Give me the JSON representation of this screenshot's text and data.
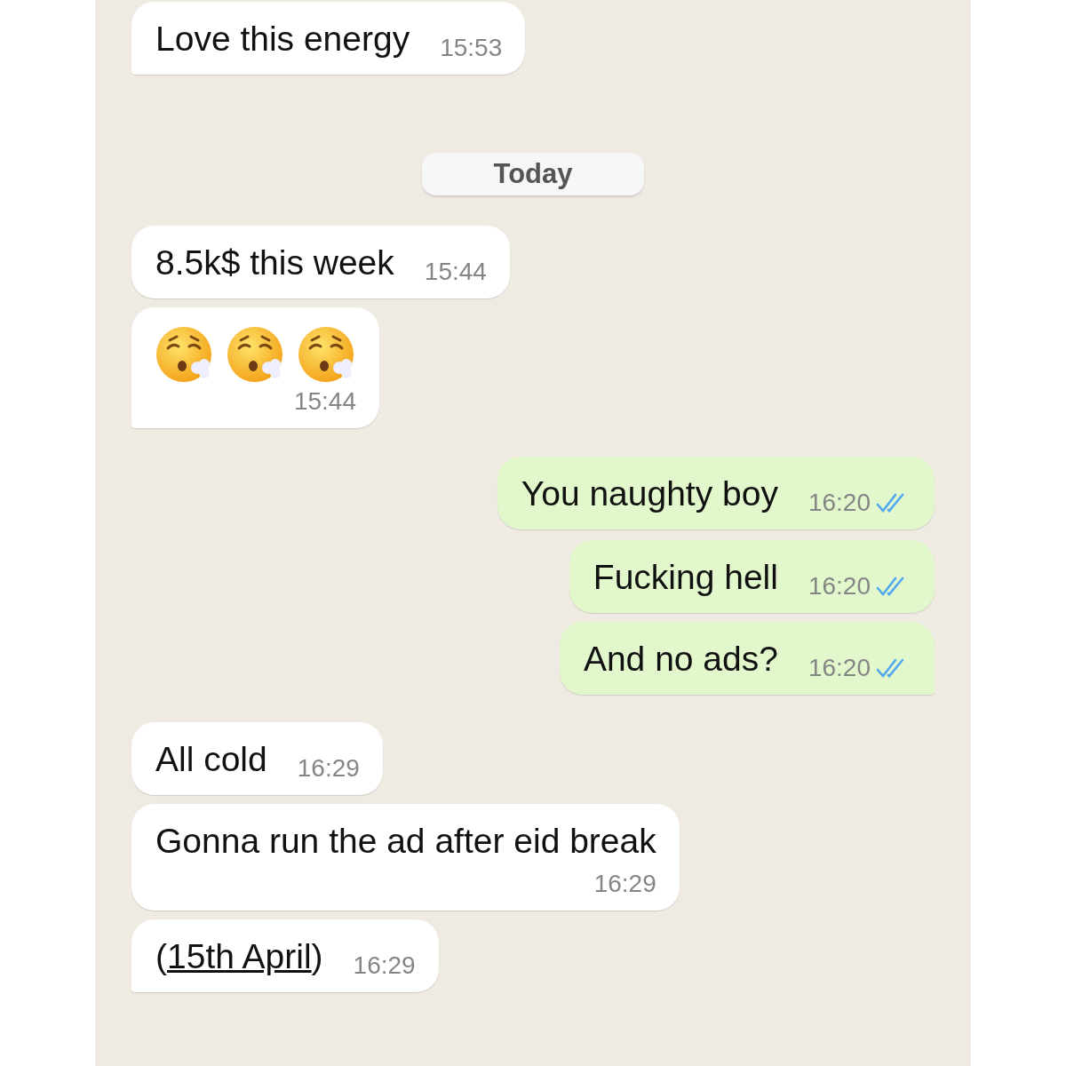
{
  "messages": [
    {
      "kind": "text",
      "sent": false,
      "text": "Love this energy",
      "time": "15:53",
      "tail": true
    },
    {
      "kind": "date",
      "text": "Today"
    },
    {
      "kind": "text",
      "sent": false,
      "text": "8.5k$ this week",
      "time": "15:44",
      "tail": false
    },
    {
      "kind": "emoji",
      "sent": false,
      "emojis": [
        {
          "kind": "exhaling_face"
        },
        {
          "kind": "exhaling_face"
        },
        {
          "kind": "exhaling_face"
        }
      ],
      "time": "15:44",
      "tail": true
    },
    {
      "kind": "text",
      "sent": true,
      "text": "You naughty boy",
      "time": "16:20",
      "read": true,
      "tail": false
    },
    {
      "kind": "text",
      "sent": true,
      "text": "Fucking hell",
      "time": "16:20",
      "read": true,
      "tail": false
    },
    {
      "kind": "text",
      "sent": true,
      "text": "And no ads?",
      "time": "16:20",
      "read": true,
      "tail": true
    },
    {
      "kind": "text",
      "sent": false,
      "text": "All cold",
      "time": "16:29",
      "tail": false
    },
    {
      "kind": "text",
      "sent": false,
      "text": "Gonna run the ad after eid break",
      "time": "16:29",
      "tail": false,
      "wrap_time": true
    },
    {
      "kind": "link",
      "sent": false,
      "before": "(",
      "link": "15th April",
      "after": ")",
      "time": "16:29",
      "tail": true
    }
  ]
}
